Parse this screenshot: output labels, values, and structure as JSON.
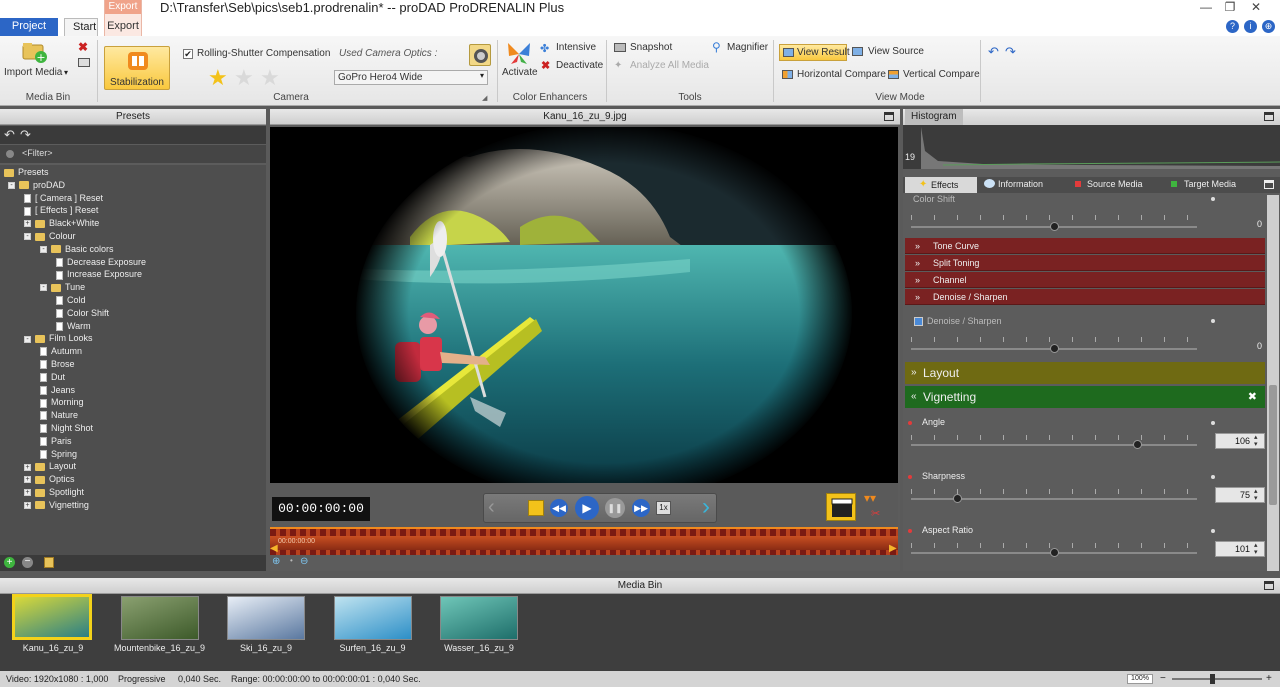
{
  "window": {
    "title": "D:\\Transfer\\Seb\\pics\\seb1.prodrenalin* -- proDAD ProDRENALIN Plus",
    "minimize": "—",
    "maximize": "❐",
    "close": "✕"
  },
  "tabs": {
    "project": "Project",
    "start": "Start",
    "export_context": "Export",
    "export": "Export"
  },
  "help": {
    "help": "?",
    "info": "i",
    "web": "⊕"
  },
  "ribbon": {
    "media_bin": {
      "import_label": "Import Media",
      "group": "Media Bin"
    },
    "stabilization": {
      "label": "Stabilization"
    },
    "camera": {
      "rolling_shutter": "Rolling-Shutter Compensation",
      "used_optics_label": "Used Camera Optics :",
      "optics_value": "GoPro Hero4 Wide",
      "group": "Camera",
      "stars_filled": 1,
      "stars_total": 3
    },
    "color": {
      "activate": "Activate",
      "intensive": "Intensive",
      "deactivate": "Deactivate",
      "group": "Color Enhancers"
    },
    "tools": {
      "snapshot": "Snapshot",
      "magnifier": "Magnifier",
      "analyze": "Analyze All Media",
      "group": "Tools"
    },
    "view": {
      "view_result": "View Result",
      "view_source": "View Source",
      "horizontal": "Horizontal Compare",
      "vertical": "Vertical Compare",
      "group": "View Mode"
    }
  },
  "presets": {
    "title": "Presets",
    "filter": "<Filter>",
    "tree": [
      {
        "label": "Presets",
        "level": 0,
        "type": "root"
      },
      {
        "label": "proDAD",
        "level": 0,
        "type": "folder",
        "exp": "-"
      },
      {
        "label": "[ Camera ]  Reset",
        "level": 1,
        "type": "doc"
      },
      {
        "label": "[ Effects ]  Reset",
        "level": 1,
        "type": "doc"
      },
      {
        "label": "Black+White",
        "level": 1,
        "type": "folder",
        "exp": "+"
      },
      {
        "label": "Colour",
        "level": 1,
        "type": "folder",
        "exp": "-"
      },
      {
        "label": "Basic colors",
        "level": 2,
        "type": "folder",
        "exp": "-"
      },
      {
        "label": "Decrease Exposure",
        "level": 3,
        "type": "doc"
      },
      {
        "label": "Increase Exposure",
        "level": 3,
        "type": "doc"
      },
      {
        "label": "Tune",
        "level": 2,
        "type": "folder",
        "exp": "-"
      },
      {
        "label": "Cold",
        "level": 3,
        "type": "doc"
      },
      {
        "label": "Color Shift",
        "level": 3,
        "type": "doc"
      },
      {
        "label": "Warm",
        "level": 3,
        "type": "doc"
      },
      {
        "label": "Film Looks",
        "level": 1,
        "type": "folder",
        "exp": "-"
      },
      {
        "label": "Autumn",
        "level": 2,
        "type": "doc"
      },
      {
        "label": "Brose",
        "level": 2,
        "type": "doc"
      },
      {
        "label": "Dut",
        "level": 2,
        "type": "doc"
      },
      {
        "label": "Jeans",
        "level": 2,
        "type": "doc"
      },
      {
        "label": "Morning",
        "level": 2,
        "type": "doc"
      },
      {
        "label": "Nature",
        "level": 2,
        "type": "doc"
      },
      {
        "label": "Night Shot",
        "level": 2,
        "type": "doc"
      },
      {
        "label": "Paris",
        "level": 2,
        "type": "doc"
      },
      {
        "label": "Spring",
        "level": 2,
        "type": "doc"
      },
      {
        "label": "Layout",
        "level": 1,
        "type": "folder",
        "exp": "+"
      },
      {
        "label": "Optics",
        "level": 1,
        "type": "folder",
        "exp": "+"
      },
      {
        "label": "Spotlight",
        "level": 1,
        "type": "folder",
        "exp": "+"
      },
      {
        "label": "Vignetting",
        "level": 1,
        "type": "folder",
        "exp": "+"
      }
    ]
  },
  "preview": {
    "filename": "Kanu_16_zu_9.jpg",
    "timecode": "00:00:00:00",
    "timeline_time": "00:00:00:00",
    "speed": "1x"
  },
  "histogram": {
    "title": "Histogram",
    "value": "19"
  },
  "effects_tabs": {
    "effects": "Effects",
    "information": "Information",
    "source": "Source Media",
    "target": "Target Media"
  },
  "effects": {
    "color_shift": {
      "label": "Color Shift",
      "value": "0",
      "position": 0.5
    },
    "rows": [
      "Tone Curve",
      "Split Toning",
      "Channel",
      "Denoise / Sharpen"
    ],
    "denoise": {
      "label": "Denoise / Sharpen",
      "value": "0",
      "position": 0.5
    },
    "layout": "Layout",
    "vignetting": "Vignetting",
    "params": [
      {
        "label": "Angle",
        "value": "106",
        "position": 0.79
      },
      {
        "label": "Sharpness",
        "value": "75",
        "position": 0.16
      },
      {
        "label": "Aspect Ratio",
        "value": "101",
        "position": 0.5
      }
    ]
  },
  "mediabin": {
    "title": "Media Bin",
    "items": [
      {
        "label": "Kanu_16_zu_9",
        "selected": true
      },
      {
        "label": "Mountenbike_16_zu_9",
        "selected": false
      },
      {
        "label": "Ski_16_zu_9",
        "selected": false
      },
      {
        "label": "Surfen_16_zu_9",
        "selected": false
      },
      {
        "label": "Wasser_16_zu_9",
        "selected": false
      }
    ]
  },
  "status": {
    "video": "Video: 1920x1080 : 1,000",
    "scan": "Progressive",
    "duration": "0,040 Sec.",
    "range": "Range: 00:00:00:00 to 00:00:00:01 : 0,040 Sec.",
    "zoom": "100%"
  }
}
